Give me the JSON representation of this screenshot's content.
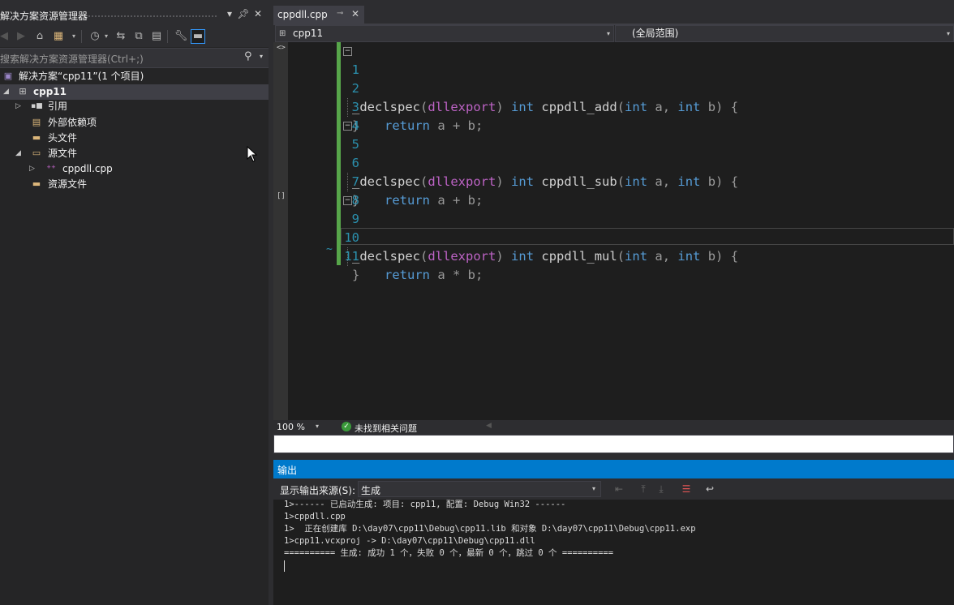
{
  "solution_explorer": {
    "title": "解决方案资源管理器",
    "search_placeholder": "搜索解决方案资源管理器(Ctrl+;)",
    "tree": [
      {
        "label": "解决方案“cpp11”(1 个项目)",
        "icon": "solution-icon"
      },
      {
        "label": "cpp11",
        "icon": "project-icon",
        "selected": true
      },
      {
        "label": "引用",
        "icon": "references-icon"
      },
      {
        "label": "外部依赖项",
        "icon": "external-deps-icon"
      },
      {
        "label": "头文件",
        "icon": "folder-icon"
      },
      {
        "label": "源文件",
        "icon": "folder-icon"
      },
      {
        "label": "cppdll.cpp",
        "icon": "cpp-file-icon"
      },
      {
        "label": "资源文件",
        "icon": "folder-icon"
      }
    ]
  },
  "editor": {
    "tab_label": "cppdll.cpp",
    "project_dropdown": "cpp11",
    "scope_dropdown": "(全局范围)",
    "zoom": "100 %",
    "issues_text": "未找到相关问题",
    "line_numbers": [
      "1",
      "2",
      "3",
      "4",
      "5",
      "6",
      "7",
      "8",
      "9",
      "10",
      "11"
    ],
    "code": {
      "l1": {
        "decl": "_declspec",
        "p1": "(",
        "macro": "dllexport",
        "p2": ")",
        "type": "int",
        "fn": "cppdll_add",
        "p3": "(",
        "t1": "int",
        "a1": " a, ",
        "t2": "int",
        "a2": " b) {"
      },
      "l2": {
        "kw": "return",
        "rest": " a + b;"
      },
      "l3": "}",
      "l5": {
        "decl": "_declspec",
        "p1": "(",
        "macro": "dllexport",
        "p2": ")",
        "type": "int",
        "fn": "cppdll_sub",
        "p3": "(",
        "t1": "int",
        "a1": " a, ",
        "t2": "int",
        "a2": " b) {"
      },
      "l6": {
        "kw": "return",
        "rest": " a + b;"
      },
      "l7": "}",
      "l9": {
        "decl": "_declspec",
        "p1": "(",
        "macro": "dllexport",
        "p2": ")",
        "type": "int",
        "fn": "cppdll_mul",
        "p3": "(",
        "t1": "int",
        "a1": " a, ",
        "t2": "int",
        "a2": " b) {"
      },
      "l10": {
        "kw": "return",
        "rest": " a * b;"
      },
      "l11": "}"
    }
  },
  "output": {
    "title": "输出",
    "source_label": "显示输出来源(S):",
    "source_value": "生成",
    "lines": [
      "1>------ 已启动生成: 项目: cpp11, 配置: Debug Win32 ------",
      "1>cppdll.cpp",
      "1>  正在创建库 D:\\day07\\cpp11\\Debug\\cpp11.lib 和对象 D:\\day07\\cpp11\\Debug\\cpp11.exp",
      "1>cpp11.vcxproj -> D:\\day07\\cpp11\\Debug\\cpp11.dll",
      "========== 生成: 成功 1 个，失败 0 个，最新 0 个，跳过 0 个 =========="
    ]
  },
  "colors": {
    "accent": "#007acc",
    "keyword": "#569cd6",
    "macro": "#bd63c5",
    "line_number": "#2b91af",
    "change_bar": "#57a64a"
  }
}
